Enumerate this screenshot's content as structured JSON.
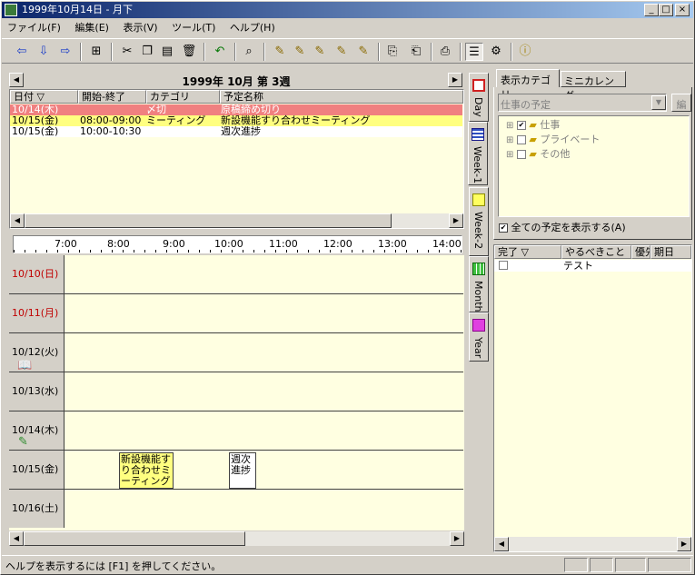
{
  "window": {
    "title": "1999年10月14日 - 月下"
  },
  "menu": [
    "ファイル(F)",
    "編集(E)",
    "表示(V)",
    "ツール(T)",
    "ヘルプ(H)"
  ],
  "calendar": {
    "week_title": "1999年 10月 第 3週"
  },
  "list": {
    "headers": [
      "日付 ▽",
      "開始-終了",
      "カテゴリ",
      "予定名称"
    ],
    "rows": [
      {
        "date": "10/14(木)",
        "time": "",
        "category": "〆切",
        "title": "原稿締め切り"
      },
      {
        "date": "10/15(金)",
        "time": "08:00-09:00",
        "category": "ミーティング",
        "title": "新設機能すり合わせミーティング"
      },
      {
        "date": "10/15(金)",
        "time": "10:00-10:30",
        "category": "",
        "title": "週次進捗"
      }
    ]
  },
  "timeline": {
    "hours": [
      "7:00",
      "8:00",
      "9:00",
      "10:00",
      "11:00",
      "12:00",
      "13:00",
      "14:00"
    ],
    "days": [
      "10/10(日)",
      "10/11(月)",
      "10/12(火)",
      "10/13(水)",
      "10/14(木)",
      "10/15(金)",
      "10/16(土)"
    ],
    "events": [
      "新設機能すり合わせミーティング",
      "週次進捗"
    ]
  },
  "view_tabs": [
    "Day",
    "Week-1",
    "Week-2",
    "Month",
    "Year"
  ],
  "right_tabs": [
    "表示カテゴリ",
    "ミニカレンダー"
  ],
  "category_panel": {
    "combo_value": "仕事の予定",
    "edit_button": "編",
    "tree": [
      "仕事",
      "プライベート",
      "その他"
    ],
    "show_all_label": "全ての予定を表示する(A)"
  },
  "todo": {
    "headers": [
      "完了 ▽",
      "やるべきこと",
      "優先",
      "期日"
    ],
    "items": [
      {
        "task": "テスト"
      }
    ]
  },
  "statusbar": {
    "text": "ヘルプを表示するには [F1] を押してください。"
  },
  "colors": {
    "highlight_red": "#f08080",
    "highlight_yellow": "#ffff80",
    "panel_bg": "#ffffe1",
    "title_bar": "#0a246a"
  }
}
